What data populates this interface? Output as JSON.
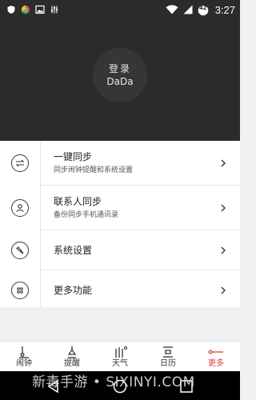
{
  "status_bar": {
    "time": "3:27",
    "battery_level": "42",
    "left_icons": [
      "shield-icon",
      "chrome-icon",
      "image-icon",
      "equalizer-icon"
    ],
    "right_icons": [
      "wifi-icon",
      "signal-icon",
      "battery-icon"
    ]
  },
  "header": {
    "login_title": "登录",
    "login_name": "DaDa"
  },
  "menu": {
    "items": [
      {
        "icon": "sync-arrows-icon",
        "title": "一键同步",
        "subtitle": "同步闹钟提醒和系统设置"
      },
      {
        "icon": "contact-person-icon",
        "title": "联系人同步",
        "subtitle": "备份同步手机通讯录"
      },
      {
        "icon": "wrench-icon",
        "title": "系统设置",
        "subtitle": ""
      },
      {
        "icon": "more-dots-icon",
        "title": "更多功能",
        "subtitle": ""
      }
    ]
  },
  "tabs": [
    {
      "icon": "alarm-clock-icon",
      "label": "闹钟",
      "active": false
    },
    {
      "icon": "reminder-icon",
      "label": "提醒",
      "active": false
    },
    {
      "icon": "weather-icon",
      "label": "天气",
      "active": false
    },
    {
      "icon": "calendar-icon",
      "label": "日历",
      "active": false
    },
    {
      "icon": "more-icon",
      "label": "更多",
      "active": true
    }
  ],
  "watermark": "新毒手游 • SIXINYI.COM",
  "colors": {
    "header_bg": "#2b2b2b",
    "accent": "#d9453a",
    "menu_bg": "#ffffff",
    "page_bg": "#f1f1f1"
  }
}
